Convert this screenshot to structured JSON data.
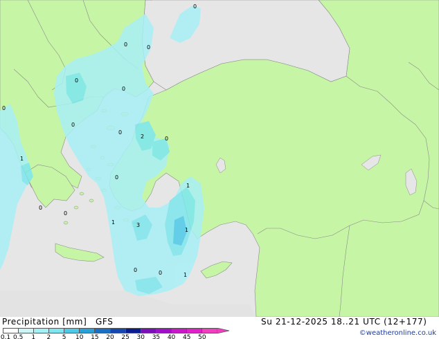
{
  "footer": {
    "title": "Precipitation [mm]",
    "model": "GFS",
    "datetime": "Su 21-12-2025 18..21 UTC (12+177)",
    "credit": "©weatheronline.co.uk"
  },
  "colorbar": {
    "labels": [
      "0.1",
      "0.5",
      "1",
      "2",
      "5",
      "10",
      "15",
      "20",
      "25",
      "30",
      "35",
      "40",
      "45",
      "50"
    ],
    "colors": [
      "#ffffff",
      "#cdf5f8",
      "#a3f0f6",
      "#7ee6ee",
      "#4ec9e8",
      "#2aa0d8",
      "#1a6fc4",
      "#1646b0",
      "#0c1c90",
      "#7a10b8",
      "#a010c8",
      "#c818c8",
      "#e020c8",
      "#f040c0"
    ]
  },
  "map_labels": [
    {
      "text": "0"
    },
    {
      "text": "0"
    },
    {
      "text": "0"
    },
    {
      "text": "0"
    },
    {
      "text": "0"
    },
    {
      "text": "0"
    },
    {
      "text": "0"
    },
    {
      "text": "0"
    },
    {
      "text": "2"
    },
    {
      "text": "0"
    },
    {
      "text": "1"
    },
    {
      "text": "0"
    },
    {
      "text": "0"
    },
    {
      "text": "1"
    },
    {
      "text": "3"
    },
    {
      "text": "1"
    },
    {
      "text": "1"
    },
    {
      "text": "0"
    },
    {
      "text": "0"
    },
    {
      "text": "1"
    },
    {
      "text": "0"
    }
  ],
  "colors": {
    "land": "#c4f5a3",
    "sea": "#e8e8e8",
    "border": "#9a9a9a"
  }
}
